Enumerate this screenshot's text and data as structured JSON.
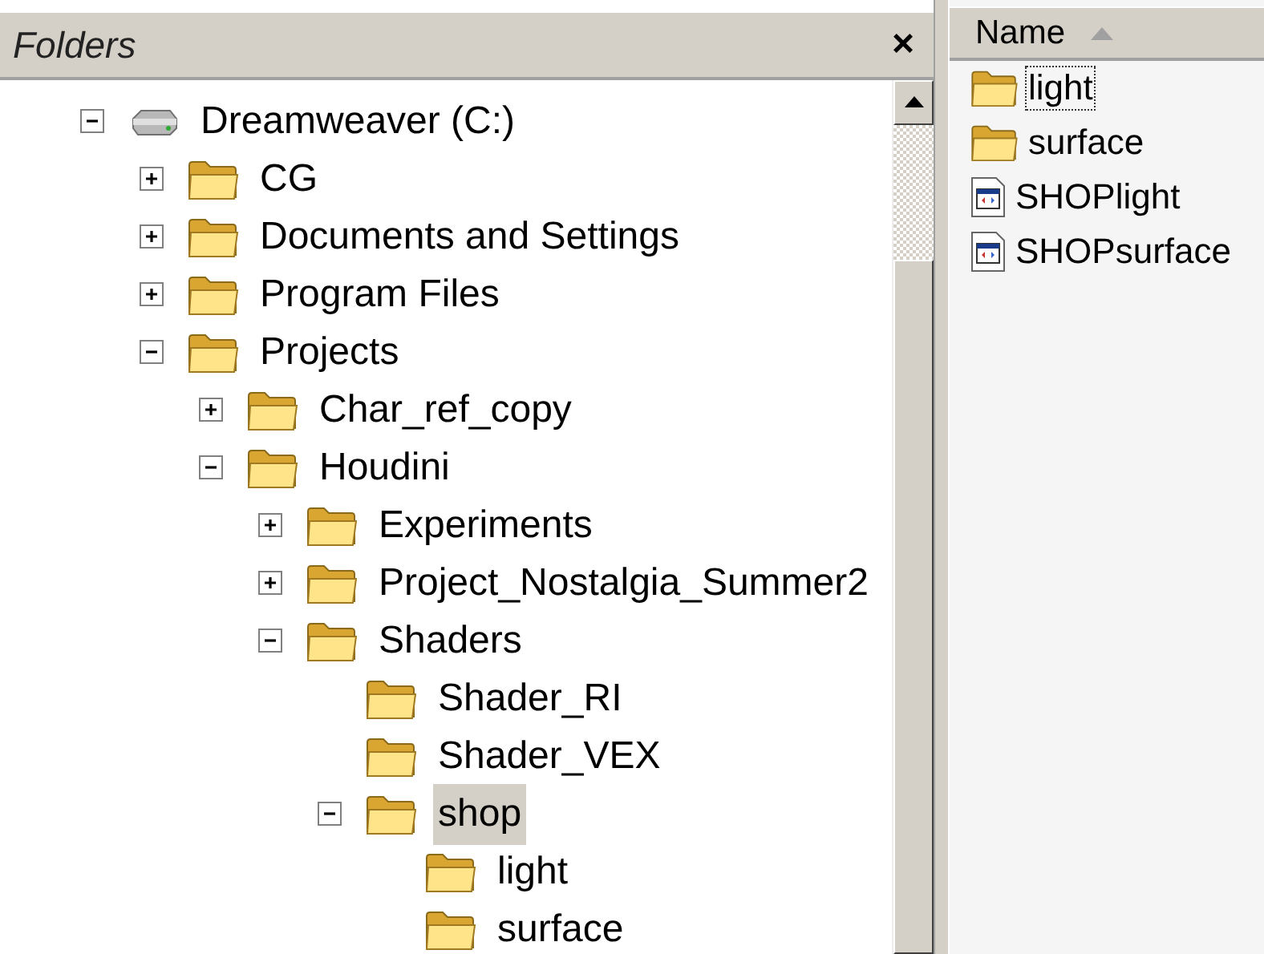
{
  "folders_pane": {
    "title": "Folders",
    "close": "×"
  },
  "tree": [
    {
      "label": "Dreamweaver (C:)",
      "kind": "drive",
      "expandable": true,
      "expanded": true,
      "selected": false,
      "children": [
        {
          "label": "CG",
          "kind": "folder",
          "expandable": true,
          "expanded": false,
          "selected": false
        },
        {
          "label": "Documents and Settings",
          "kind": "folder",
          "expandable": true,
          "expanded": false,
          "selected": false
        },
        {
          "label": "Program Files",
          "kind": "folder",
          "expandable": true,
          "expanded": false,
          "selected": false
        },
        {
          "label": "Projects",
          "kind": "folder",
          "expandable": true,
          "expanded": true,
          "selected": false,
          "children": [
            {
              "label": "Char_ref_copy",
              "kind": "folder",
              "expandable": true,
              "expanded": false,
              "selected": false
            },
            {
              "label": "Houdini",
              "kind": "folder",
              "expandable": true,
              "expanded": true,
              "selected": false,
              "children": [
                {
                  "label": "Experiments",
                  "kind": "folder",
                  "expandable": true,
                  "expanded": false,
                  "selected": false
                },
                {
                  "label": "Project_Nostalgia_Summer2",
                  "kind": "folder",
                  "expandable": true,
                  "expanded": false,
                  "selected": false
                },
                {
                  "label": "Shaders",
                  "kind": "folder",
                  "expandable": true,
                  "expanded": true,
                  "selected": false,
                  "children": [
                    {
                      "label": "Shader_RI",
                      "kind": "folder",
                      "expandable": false,
                      "selected": false
                    },
                    {
                      "label": "Shader_VEX",
                      "kind": "folder",
                      "expandable": false,
                      "selected": false
                    },
                    {
                      "label": "shop",
                      "kind": "folder",
                      "expandable": true,
                      "expanded": true,
                      "selected": true,
                      "children": [
                        {
                          "label": "light",
                          "kind": "folder",
                          "expandable": false,
                          "selected": false
                        },
                        {
                          "label": "surface",
                          "kind": "folder",
                          "expandable": false,
                          "selected": false
                        }
                      ]
                    }
                  ]
                }
              ]
            }
          ]
        }
      ]
    }
  ],
  "file_list": {
    "column": {
      "label": "Name",
      "sort_ascending": true
    },
    "items": [
      {
        "label": "light",
        "kind": "folder",
        "focused": true
      },
      {
        "label": "surface",
        "kind": "folder",
        "focused": false
      },
      {
        "label": "SHOPlight",
        "kind": "file",
        "focused": false
      },
      {
        "label": "SHOPsurface",
        "kind": "file",
        "focused": false
      }
    ]
  }
}
